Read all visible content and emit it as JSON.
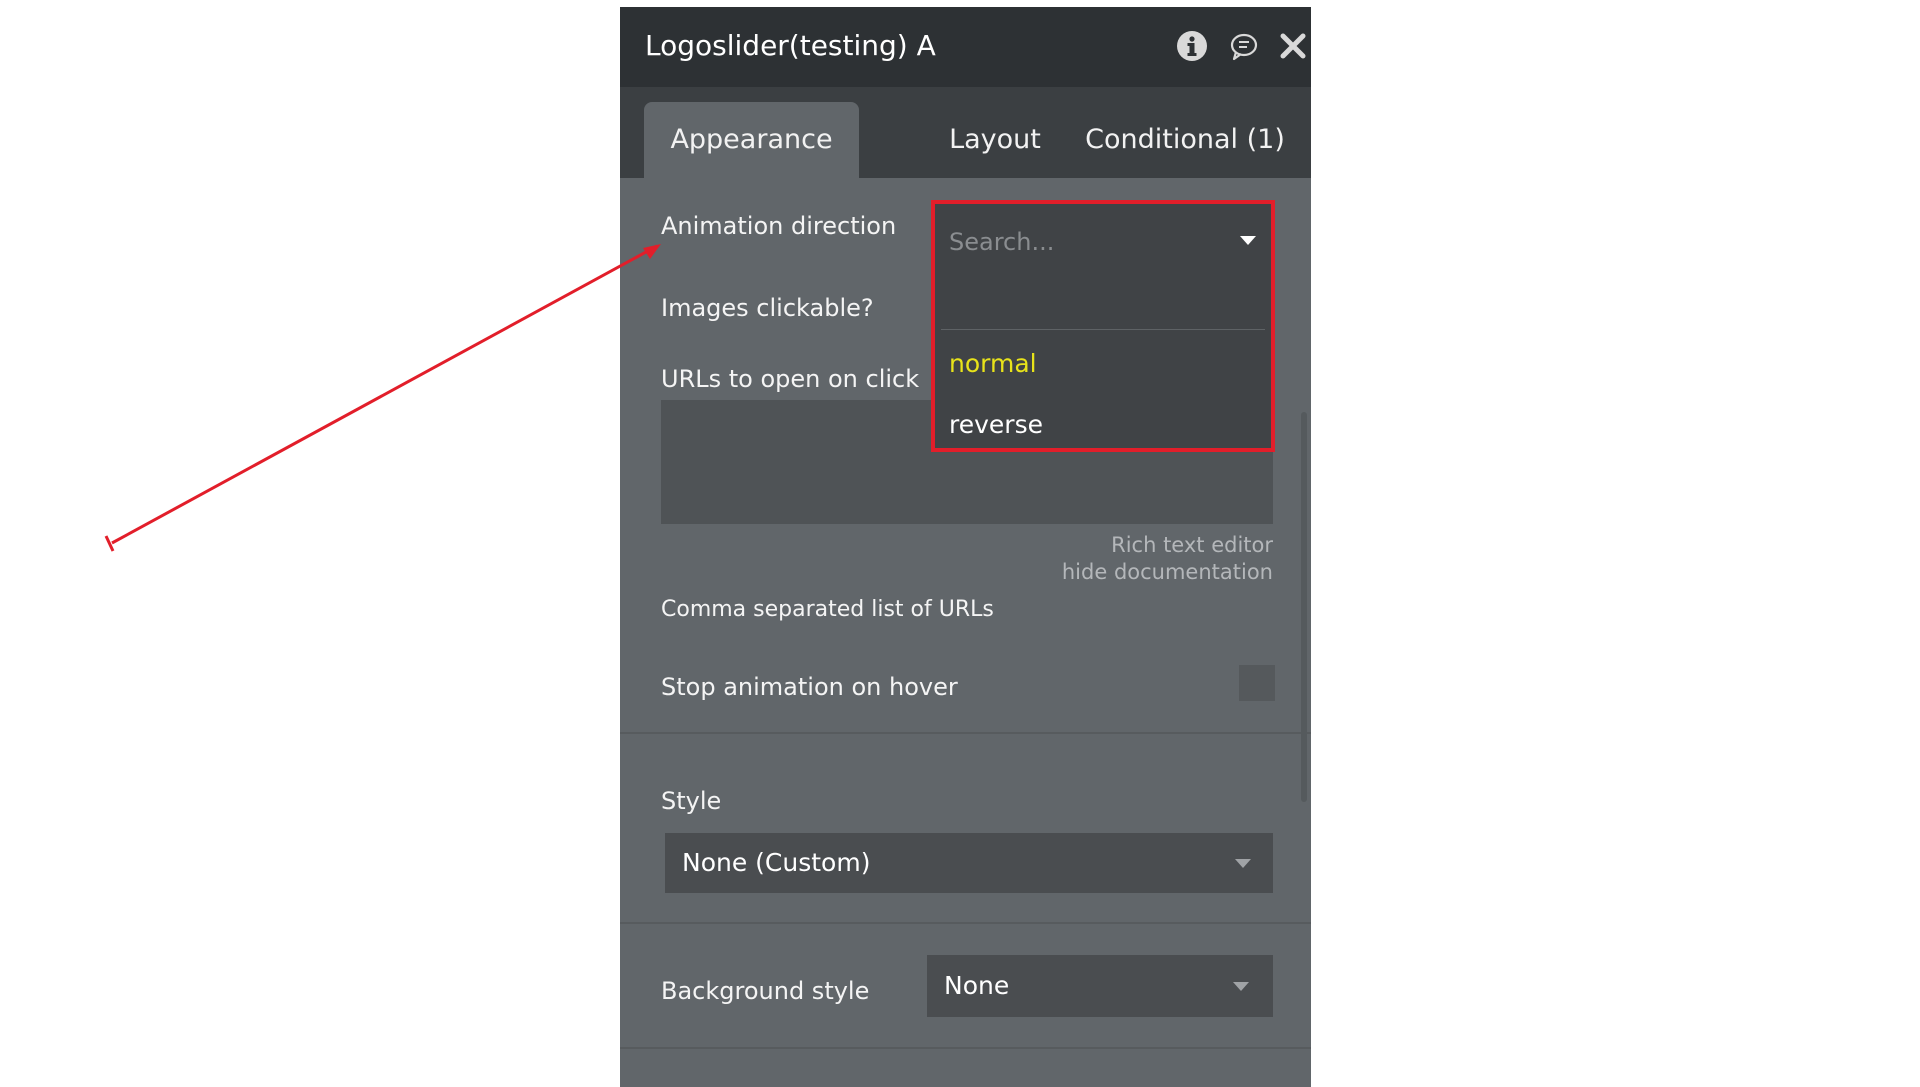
{
  "panel": {
    "title": "Logoslider(testing) A",
    "header_icons": [
      "info-icon",
      "comment-icon",
      "close-icon"
    ]
  },
  "tabs": [
    {
      "label": "Appearance",
      "active": true
    },
    {
      "label": "Layout",
      "active": false
    },
    {
      "label": "Conditional (1)",
      "active": false
    }
  ],
  "fields": {
    "animation_direction": "Animation direction",
    "images_clickable": "Images clickable?",
    "urls_to_open": "URLs to open on click",
    "rich_text_editor": "Rich text editor",
    "hide_documentation": "hide documentation",
    "comma_separated": "Comma separated list of URLs",
    "stop_animation": "Stop animation on hover",
    "stop_animation_checked": false,
    "style_label": "Style",
    "style_value": "None (Custom)",
    "background_style_label": "Background style",
    "background_style_value": "None"
  },
  "dropdown": {
    "search_placeholder": "Search...",
    "options": [
      {
        "label": "normal",
        "highlighted": true
      },
      {
        "label": "reverse",
        "highlighted": false
      }
    ]
  },
  "colors": {
    "highlight_border": "#e21e2a",
    "highlight_option": "#e8e31a",
    "panel_bg": "#61666a",
    "header_bg": "#2d3134",
    "annotation_arrow": "#e21e2a"
  }
}
